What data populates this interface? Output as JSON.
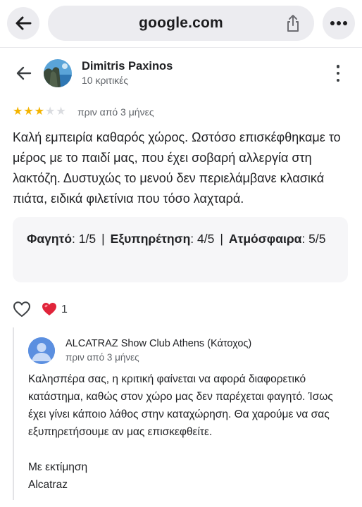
{
  "browser": {
    "url": "google.com",
    "icons": {
      "back": "back-arrow-icon",
      "share": "share-icon",
      "more": "more-dots-icon"
    }
  },
  "review": {
    "reviewer_name": "Dimitris Paxinos",
    "reviewer_meta": "10 κριτικές",
    "rating": 3,
    "rating_max": 5,
    "date": "πριν από 3 μήνες",
    "text": "Καλή εμπειρία καθαρός χώρος. Ωστόσο επισκέφθηκαμε το μέρος με το παιδί μας, που έχει σοβαρή αλλεργία στη λακτόζη. Δυστυχώς το μενού δεν περιελάμβανε κλασικά πιάτα, ειδικά φιλετίνια που τόσο λαχταρά.",
    "attributes": [
      {
        "label": "Φαγητό",
        "value": ": 1/5"
      },
      {
        "label": "Εξυπηρέτηση",
        "value": ": 4/5"
      },
      {
        "label": "Ατμόσφαιρα",
        "value": ": 5/5"
      }
    ],
    "separator": "|",
    "reaction_count": "1",
    "colors": {
      "star_on": "#f4b400",
      "star_off": "#dadce0",
      "heart": "#e0243a"
    }
  },
  "reply": {
    "owner_name": "ALCATRAZ Show Club Athens (Κάτοχος)",
    "date": "πριν από 3 μήνες",
    "paragraph": "Καλησπέρα σας, η κριτική φαίνεται να αφορά διαφορετικό κατάστημα, καθώς στον χώρο μας δεν παρέχεται φαγητό. Ίσως έχει γίνει κάποιο λάθος στην καταχώρηση. Θα χαρούμε να σας εξυπηρετήσουμε αν μας επισκεφθείτε.",
    "closing": "Με εκτίμηση",
    "signature": "Alcatraz"
  }
}
